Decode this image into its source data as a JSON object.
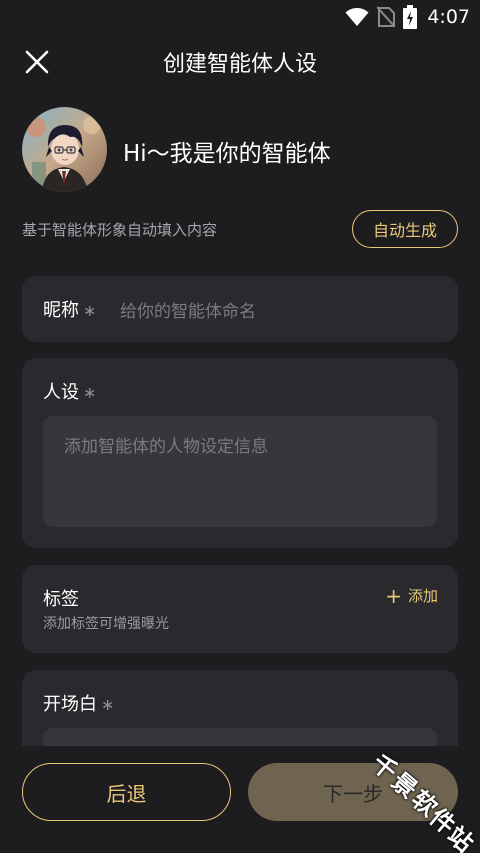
{
  "status_bar": {
    "time": "4:07",
    "icons": [
      "wifi-icon",
      "no-sim-icon",
      "battery-charging-icon"
    ]
  },
  "header": {
    "title": "创建智能体人设",
    "close_icon": "close-icon"
  },
  "profile": {
    "greeting": "Hi～我是你的智能体",
    "auto_hint": "基于智能体形象自动填入内容",
    "auto_button": "自动生成"
  },
  "form": {
    "nickname": {
      "label": "昵称",
      "required": "∗",
      "placeholder": "给你的智能体命名"
    },
    "persona": {
      "label": "人设",
      "required": "∗",
      "placeholder": "添加智能体的人物设定信息"
    },
    "tags": {
      "label": "标签",
      "hint": "添加标签可增强曝光",
      "add_icon": "+",
      "add_label": "添加"
    },
    "opening": {
      "label": "开场白",
      "required": "∗"
    }
  },
  "footer": {
    "back_label": "后退",
    "next_label": "下一步"
  },
  "watermark": [
    "千",
    "景",
    "软",
    "件",
    "站"
  ],
  "colors": {
    "background": "#1d1d20",
    "card": "#2a2a2e",
    "accent": "#e9c877",
    "next_button": "#6e6450"
  }
}
